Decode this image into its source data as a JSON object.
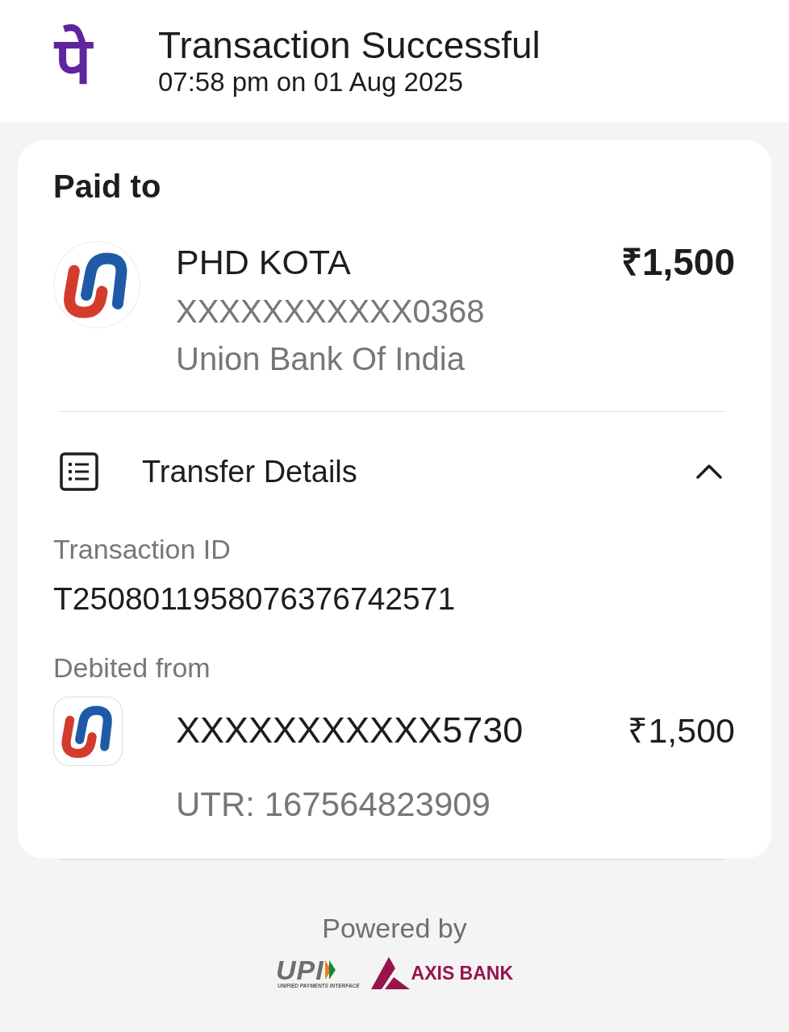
{
  "header": {
    "logo_text": "पे",
    "title": "Transaction Successful",
    "timestamp": "07:58 pm on 01 Aug 2025"
  },
  "paid_to": {
    "heading": "Paid to",
    "name": "PHD KOTA",
    "account": "XXXXXXXXXXX0368",
    "bank": "Union Bank Of India",
    "amount": "₹1,500"
  },
  "transfer_details": {
    "title": "Transfer Details",
    "expanded": true,
    "transaction_id_label": "Transaction ID",
    "transaction_id": "T2508011958076376742571",
    "debited_from_label": "Debited from",
    "debit_account": "XXXXXXXXXXX5730",
    "debit_amount": "₹1,500",
    "utr": "UTR: 167564823909"
  },
  "footer": {
    "powered_by": "Powered by",
    "upi_logo_text": "UPI",
    "upi_tagline": "UNIFIED PAYMENTS INTERFACE",
    "bank_logo_text": "AXIS BANK"
  }
}
